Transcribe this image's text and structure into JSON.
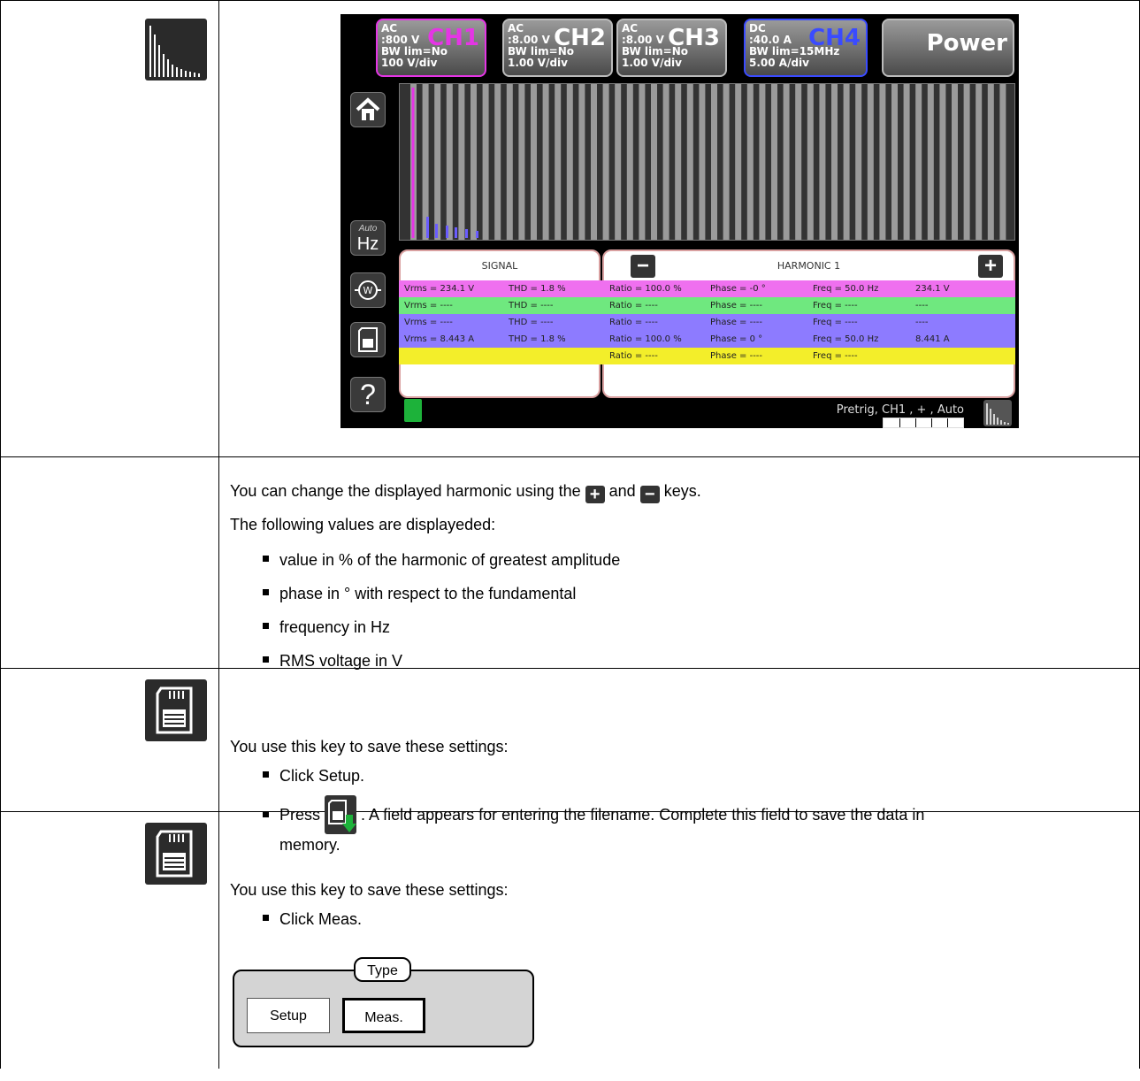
{
  "screenshot": {
    "channels": [
      {
        "lines": "AC\n:800 V\nBW lim=No\n100 V/div",
        "name": "CH1",
        "name_color": "#e535e5",
        "border": "#e535e5"
      },
      {
        "lines": "AC\n:8.00 V\nBW lim=No\n1.00 V/div",
        "name": "CH2",
        "name_color": "#ffffff",
        "border": "#bbbbbb"
      },
      {
        "lines": "AC\n:8.00 V\nBW lim=No\n1.00 V/div",
        "name": "CH3",
        "name_color": "#ffffff",
        "border": "#bbbbbb"
      },
      {
        "lines": "DC\n:40.0 A\nBW lim=15MHz\n5.00 A/div",
        "name": "CH4",
        "name_color": "#3a4bff",
        "border": "#3a4bff"
      }
    ],
    "power_label": "Power",
    "auto_label": "Auto",
    "hz_label": "Hz",
    "help_label": "?",
    "signal_header": "SIGNAL",
    "harmonic_header": "HARMONIC 1",
    "minus_label": "−",
    "plus_label": "+",
    "rows": [
      {
        "color": "#ef70ef",
        "vrms": "Vrms = 234.1 V",
        "thd": "THD = 1.8 %",
        "ratio": "Ratio = 100.0 %",
        "phase": "Phase = -0 °",
        "freq": "Freq = 50.0 Hz",
        "rms": "234.1 V"
      },
      {
        "color": "#6fe87f",
        "vrms": "Vrms = ----",
        "thd": "THD = ----",
        "ratio": "Ratio = ----",
        "phase": "Phase = ----",
        "freq": "Freq = ----",
        "rms": "----"
      },
      {
        "color": "#8d7bff",
        "vrms": "Vrms = ----",
        "thd": "THD = ----",
        "ratio": "Ratio = ----",
        "phase": "Phase = ----",
        "freq": "Freq = ----",
        "rms": "----"
      },
      {
        "color": "#8d7bff",
        "vrms": "Vrms = 8.443 A",
        "thd": "THD = 1.8 %",
        "ratio": "Ratio = 100.0 %",
        "phase": "Phase = 0 °",
        "freq": "Freq = 50.0 Hz",
        "rms": "8.441 A"
      },
      {
        "color": "#f3ee2a",
        "vrms": "",
        "thd": "",
        "ratio": "Ratio = ----",
        "phase": "Phase = ----",
        "freq": "Freq = ----",
        "rms": ""
      }
    ],
    "status_text": "Pretrig, CH1 , + , Auto"
  },
  "row2": {
    "intro_before": "You can change the displayed harmonic using the",
    "intro_and": "and",
    "intro_after": "keys.",
    "list_intro": "The following values are displayeded:",
    "bullets": [
      "value in % of the harmonic of greatest amplitude",
      "phase in ° with respect to the fundamental",
      "frequency in Hz",
      "RMS voltage in V"
    ]
  },
  "row3": {
    "intro": "You use this key to save these settings:",
    "bullet1": "Click Setup.",
    "press": "Press",
    "press_rest": ". A field appears for entering the filename. Complete this field to save the data in",
    "press_rest2": "memory."
  },
  "row4": {
    "intro": "You use this key to save these settings:",
    "bullet1": "Click Meas.",
    "type_label": "Type",
    "setup_label": "Setup",
    "meas_label": "Meas."
  }
}
